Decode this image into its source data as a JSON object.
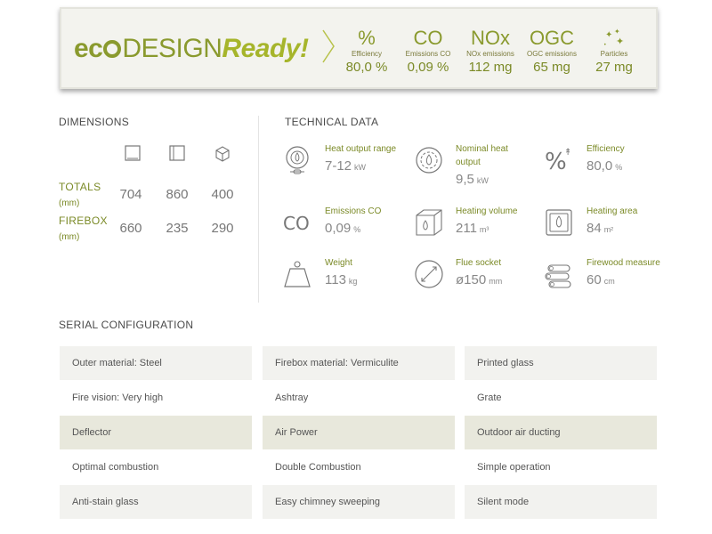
{
  "eco_banner": {
    "logo_eco": "ec",
    "logo_design": "DESIGN",
    "logo_ready": "Ready!",
    "stats": [
      {
        "symbol": "%",
        "label": "Efficiency",
        "value": "80,0 %"
      },
      {
        "symbol": "CO",
        "label": "Emissions CO",
        "value": "0,09 %"
      },
      {
        "symbol": "NOx",
        "label": "NOx emissions",
        "value": "112 mg"
      },
      {
        "symbol": "OGC",
        "label": "OGC emissions",
        "value": "65 mg"
      },
      {
        "symbol": "particles-icon",
        "label": "Particles",
        "value": "27 mg"
      }
    ]
  },
  "dimensions": {
    "title": "DIMENSIONS",
    "column_icons": [
      "front-view-icon",
      "side-view-icon",
      "cube-icon"
    ],
    "rows": [
      {
        "label": "TOTALS",
        "unit": "(mm)",
        "values": [
          "704",
          "860",
          "400"
        ]
      },
      {
        "label": "FIREBOX",
        "unit": "(mm)",
        "values": [
          "660",
          "235",
          "290"
        ]
      }
    ]
  },
  "technical": {
    "title": "TECHNICAL DATA",
    "items": [
      {
        "icon": "heat-output-icon",
        "label": "Heat output range",
        "value": "7-12",
        "unit": "kW"
      },
      {
        "icon": "nominal-heat-icon",
        "label": "Nominal heat output",
        "value": "9,5",
        "unit": "kW"
      },
      {
        "icon": "efficiency-icon",
        "label": "Efficiency",
        "value": "80,0",
        "unit": "%"
      },
      {
        "icon": "co-icon",
        "label": "Emissions CO",
        "value": "0,09",
        "unit": "%"
      },
      {
        "icon": "heating-volume-icon",
        "label": "Heating volume",
        "value": "211",
        "unit": "m³"
      },
      {
        "icon": "heating-area-icon",
        "label": "Heating area",
        "value": "84",
        "unit": "m²"
      },
      {
        "icon": "weight-icon",
        "label": "Weight",
        "value": "113",
        "unit": "kg"
      },
      {
        "icon": "flue-socket-icon",
        "label": "Flue socket",
        "value": "ø150",
        "unit": "mm"
      },
      {
        "icon": "firewood-icon",
        "label": "Firewood measure",
        "value": "60",
        "unit": "cm"
      }
    ]
  },
  "serial_configuration": {
    "title": "SERIAL CONFIGURATION",
    "rows": [
      [
        "Outer material: Steel",
        "Firebox material: Vermiculite",
        "Printed glass"
      ],
      [
        "Fire vision: Very high",
        "Ashtray",
        "Grate"
      ],
      [
        "Deflector",
        "Air Power",
        "Outdoor air ducting"
      ],
      [
        "Optimal combustion",
        "Double Combustion",
        "Simple operation"
      ],
      [
        "Anti-stain glass",
        "Easy chimney sweeping",
        "Silent mode"
      ]
    ]
  },
  "colors": {
    "accent": "#8a9a2e",
    "label_green": "#7b8a27",
    "row_highlight": "#e8e8dc",
    "row_light": "#f2f2ef"
  }
}
